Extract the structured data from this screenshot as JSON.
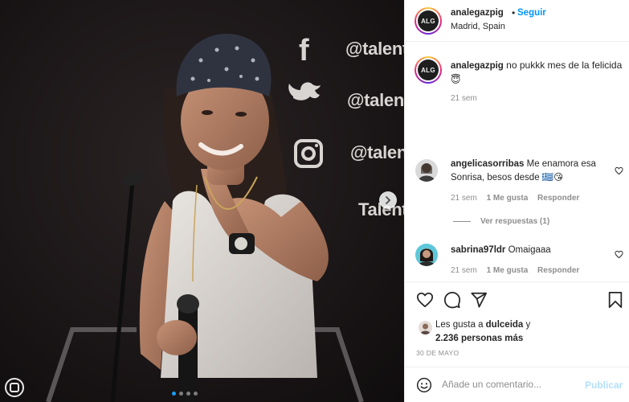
{
  "photo": {
    "background_handles": [
      "@talent",
      "@talent",
      "@talent",
      "Talent"
    ],
    "carousel_dots": 4,
    "active_dot": 0
  },
  "post": {
    "avatar_initials": "ALG",
    "username": "analegazpig",
    "bullet": "•",
    "follow_label": "Seguir",
    "location": "Madrid, Spain",
    "caption": "no pukkk mes de la felicida 😇",
    "caption_time": "21 sem"
  },
  "comments": [
    {
      "username": "angelicasorribas",
      "text": "Me enamora esa Sonrisa, besos desde 🇬🇷😘",
      "time": "21 sem",
      "likes": "1 Me gusta",
      "reply": "Responder",
      "view_replies": "Ver respuestas (1)"
    },
    {
      "username": "sabrina97ldr",
      "text": "Omaigaaa",
      "time": "21 sem",
      "likes": "1 Me gusta",
      "reply": "Responder"
    }
  ],
  "likes": {
    "prefix": "Les gusta a ",
    "first_user": "dulceida",
    "joiner": " y",
    "others": "2.236 personas más"
  },
  "date": "30 DE MAYO",
  "composer": {
    "placeholder": "Añade un comentario...",
    "post_label": "Publicar"
  },
  "colors": {
    "link_blue": "#0095f6",
    "post_disabled": "#b2dffc",
    "muted": "#8e8e8e",
    "carousel_active": "#1a9cf2"
  }
}
